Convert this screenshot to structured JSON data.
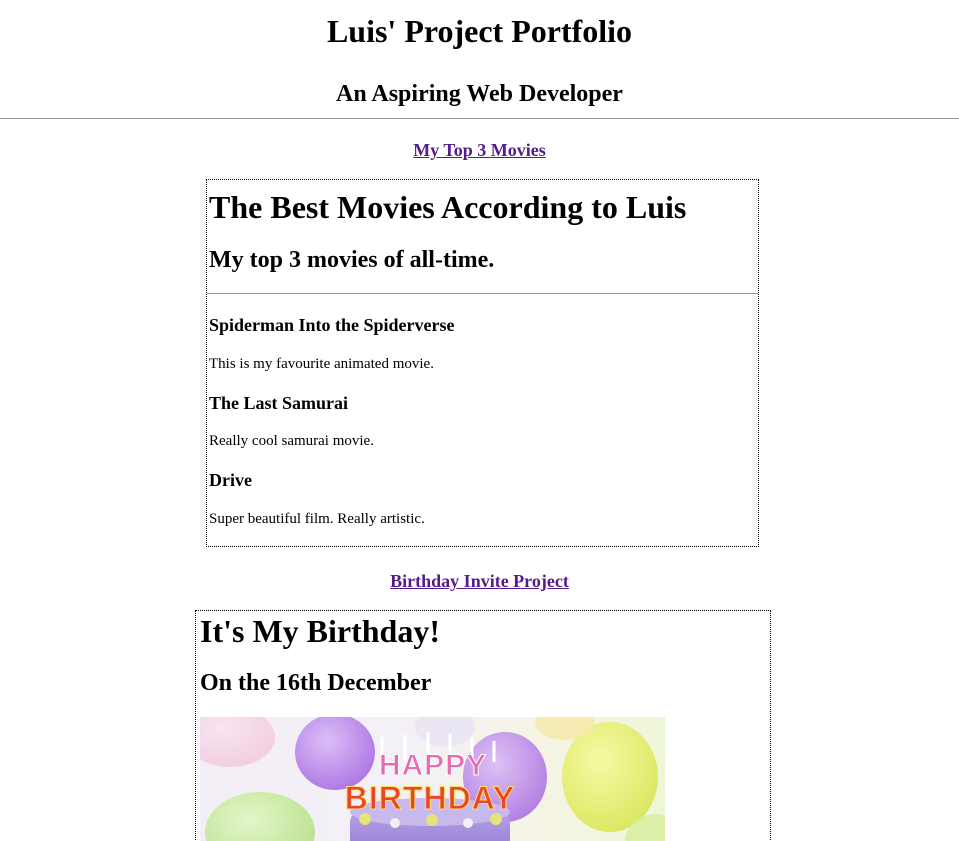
{
  "header": {
    "title": "Luis' Project Portfolio",
    "subtitle": "An Aspiring Web Developer"
  },
  "projects": [
    {
      "link_label": "My Top 3 Movies",
      "preview": {
        "title": "The Best Movies According to Luis",
        "subtitle": "My top 3 movies of all-time.",
        "movies": [
          {
            "name": "Spiderman Into the Spiderverse",
            "description": "This is my favourite animated movie."
          },
          {
            "name": "The Last Samurai",
            "description": "Really cool samurai movie."
          },
          {
            "name": "Drive",
            "description": "Super beautiful film. Really artistic."
          }
        ]
      }
    },
    {
      "link_label": "Birthday Invite Project",
      "preview": {
        "title": "It's My Birthday!",
        "subtitle": "On the 16th December",
        "image": {
          "icon": "birthday-cake-image",
          "text_line1": "HAPPY",
          "text_line2": "BIRTHDAY"
        }
      }
    }
  ],
  "colors": {
    "link_visited": "#551a8b",
    "rule": "#9a9a9a",
    "cake_purple": "#9f86d8",
    "balloon_purple": "#b16ee6",
    "balloon_yellow": "#e5ef5c",
    "balloon_green": "#bfe89a"
  }
}
